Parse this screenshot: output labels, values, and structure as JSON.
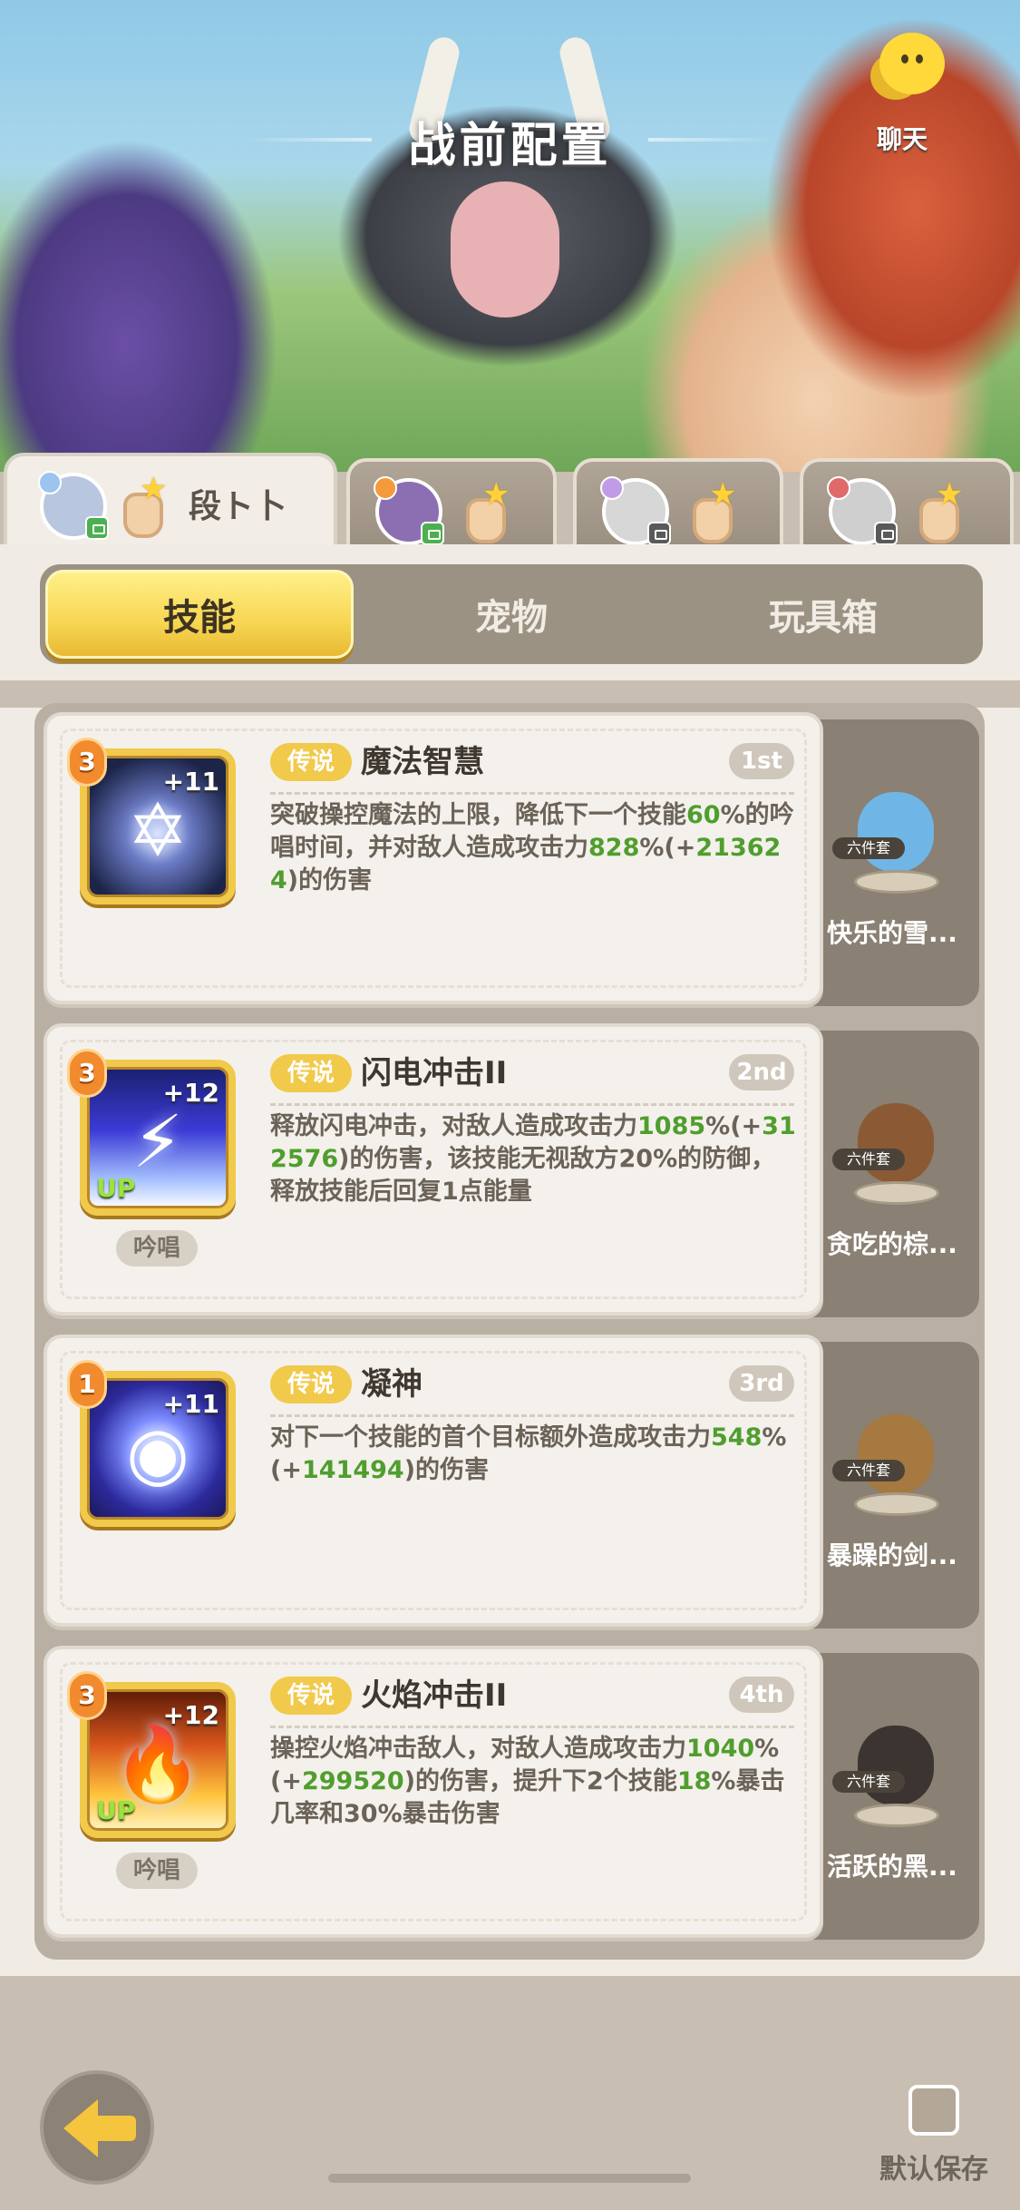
{
  "header": {
    "title": "战前配置",
    "chat_label": "聊天"
  },
  "players": [
    {
      "name": "段ト卜",
      "active": true
    },
    {
      "name": "",
      "active": false
    },
    {
      "name": "",
      "active": false
    },
    {
      "name": "",
      "active": false
    }
  ],
  "tabs": [
    {
      "label": "技能",
      "active": true
    },
    {
      "label": "宠物",
      "active": false
    },
    {
      "label": "玩具箱",
      "active": false
    }
  ],
  "skills": [
    {
      "level": "3",
      "plus": "+11",
      "up": "",
      "chant": "",
      "rarity": "传说",
      "name": "魔法智慧",
      "rank": "1st",
      "desc_parts": [
        {
          "t": "突破操控魔法的上限，降低下一个技能",
          "g": false
        },
        {
          "t": "60",
          "g": true
        },
        {
          "t": "%的吟唱时间，并对敌人造成攻击力",
          "g": false
        },
        {
          "t": "828",
          "g": true
        },
        {
          "t": "%(+",
          "g": false
        },
        {
          "t": "213624",
          "g": true
        },
        {
          "t": ")的伤害",
          "g": false
        }
      ],
      "pet": {
        "set": "六件套",
        "name": "快乐的雪..."
      }
    },
    {
      "level": "3",
      "plus": "+12",
      "up": "UP",
      "chant": "吟唱",
      "rarity": "传说",
      "name": "闪电冲击II",
      "rank": "2nd",
      "desc_parts": [
        {
          "t": "释放闪电冲击，对敌人造成攻击力",
          "g": false
        },
        {
          "t": "1085",
          "g": true
        },
        {
          "t": "%(+",
          "g": false
        },
        {
          "t": "312576",
          "g": true
        },
        {
          "t": ")的伤害，该技能无视敌方20%的防御，释放技能后回复1点能量",
          "g": false
        }
      ],
      "pet": {
        "set": "六件套",
        "name": "贪吃的棕..."
      }
    },
    {
      "level": "1",
      "plus": "+11",
      "up": "",
      "chant": "",
      "rarity": "传说",
      "name": "凝神",
      "rank": "3rd",
      "desc_parts": [
        {
          "t": "对下一个技能的首个目标额外造成攻击力",
          "g": false
        },
        {
          "t": "548",
          "g": true
        },
        {
          "t": "%(+",
          "g": false
        },
        {
          "t": "141494",
          "g": true
        },
        {
          "t": ")的伤害",
          "g": false
        }
      ],
      "pet": {
        "set": "六件套",
        "name": "暴躁的剑..."
      }
    },
    {
      "level": "3",
      "plus": "+12",
      "up": "UP",
      "chant": "吟唱",
      "rarity": "传说",
      "name": "火焰冲击II",
      "rank": "4th",
      "desc_parts": [
        {
          "t": "操控火焰冲击敌人，对敌人造成攻击力",
          "g": false
        },
        {
          "t": "1040",
          "g": true
        },
        {
          "t": "%(+",
          "g": false
        },
        {
          "t": "299520",
          "g": true
        },
        {
          "t": ")的伤害，提升下2个技能",
          "g": false
        },
        {
          "t": "18",
          "g": true
        },
        {
          "t": "%暴击几率和30%暴击伤害",
          "g": false
        }
      ],
      "pet": {
        "set": "六件套",
        "name": "活跃的黑..."
      }
    }
  ],
  "footer": {
    "save_label": "默认保存"
  },
  "colors": {
    "accent_yellow": "#f7d652",
    "value_green": "#4f9e2e",
    "panel_bg": "#f0ece5"
  }
}
